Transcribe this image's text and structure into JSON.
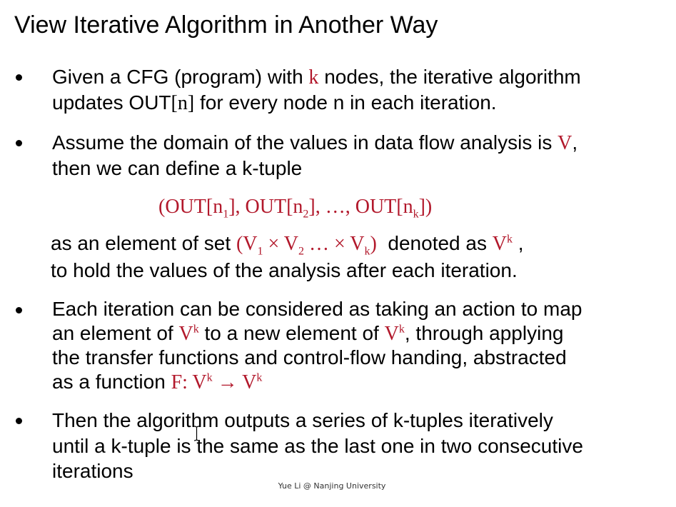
{
  "slide": {
    "title": "View Iterative Algorithm in Another Way",
    "bullet1": {
      "l1_a": "Given a CFG (program) with ",
      "l1_k": "k",
      "l1_b": " nodes, the iterative algorithm",
      "l2_a": "updates OUT",
      "l2_n": "[n]",
      "l2_b": " for every node n in each iteration."
    },
    "bullet2": {
      "l1_a": "Assume the domain of the values in data flow analysis is ",
      "l1_v": "V",
      "l1_b": ",",
      "l2": "then we can define a k-tuple",
      "tuple": {
        "p1": "(OUT[n",
        "s1": "1",
        "p2": "], OUT[n",
        "s2": "2",
        "p3": "], …, OUT[n",
        "sk": "k",
        "p4": "])"
      },
      "l3_a": "as an element of set ",
      "set": {
        "p1": "(V",
        "s1": "1",
        "p2": " × V",
        "s2": "2",
        "p3": " … × V",
        "sk": "k",
        "p4": ")"
      },
      "l3_b": "  denoted as ",
      "vk_v": "V",
      "vk_sup": "k",
      "l3_c": " ,",
      "l4": "to hold the values of the analysis after each iteration."
    },
    "bullet3": {
      "l1": "Each iteration can be considered as taking an action to map",
      "l2_a": "an element of ",
      "v": "V",
      "k": "k",
      "l2_b": " to a new element of ",
      "l2_c": ", through applying",
      "l3": "the transfer functions and control-flow handing, abstracted",
      "l4_a": "as a function ",
      "fn_a": "F: V",
      "fn_arrow": " → V"
    },
    "bullet4": {
      "l1": "Then the algorithm outputs a series of k-tuples iteratively",
      "l2": "until a k-tuple is the same as the last one in two consecutive",
      "l3": "iterations"
    },
    "footer": "Yue Li @ Nanjing University"
  }
}
